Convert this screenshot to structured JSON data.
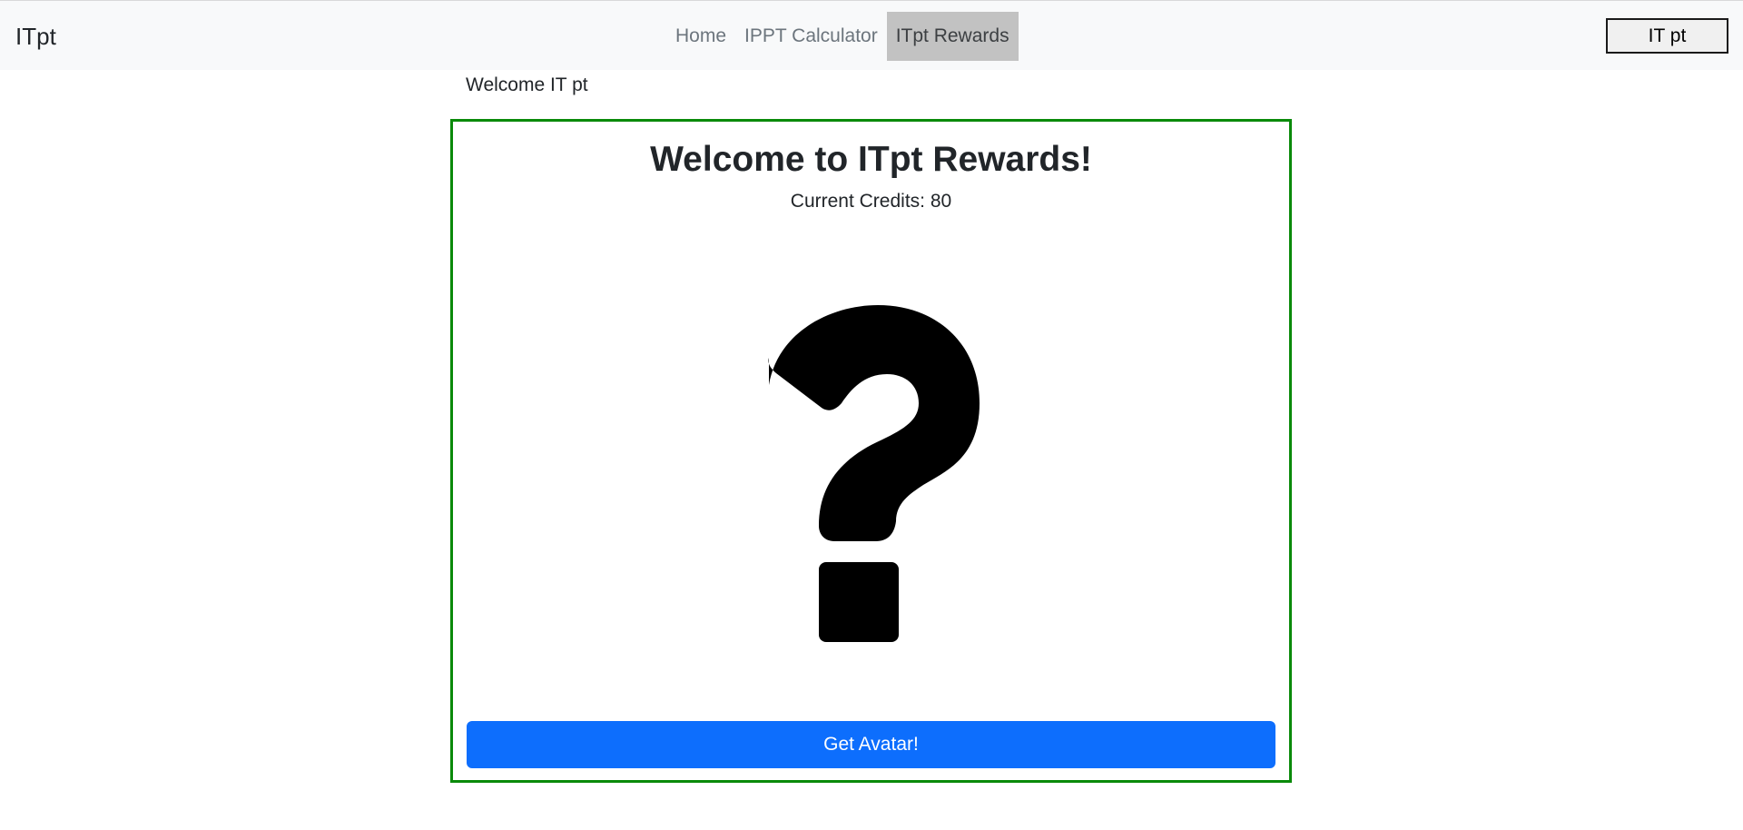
{
  "navbar": {
    "brand": "ITpt",
    "links": [
      {
        "label": "Home",
        "active": false
      },
      {
        "label": "IPPT Calculator",
        "active": false
      },
      {
        "label": "ITpt Rewards",
        "active": true
      }
    ],
    "user_button": "IT pt",
    "active_bg": "#c2c2c2"
  },
  "welcome_user": "Welcome IT pt",
  "rewards": {
    "title": "Welcome to ITpt Rewards!",
    "credits_label": "Current Credits:",
    "credits_value": "80",
    "avatar_icon": "question-mark-icon",
    "get_avatar_label": "Get Avatar!",
    "border_color": "#0a8a0a",
    "button_color": "#0d6efd"
  }
}
